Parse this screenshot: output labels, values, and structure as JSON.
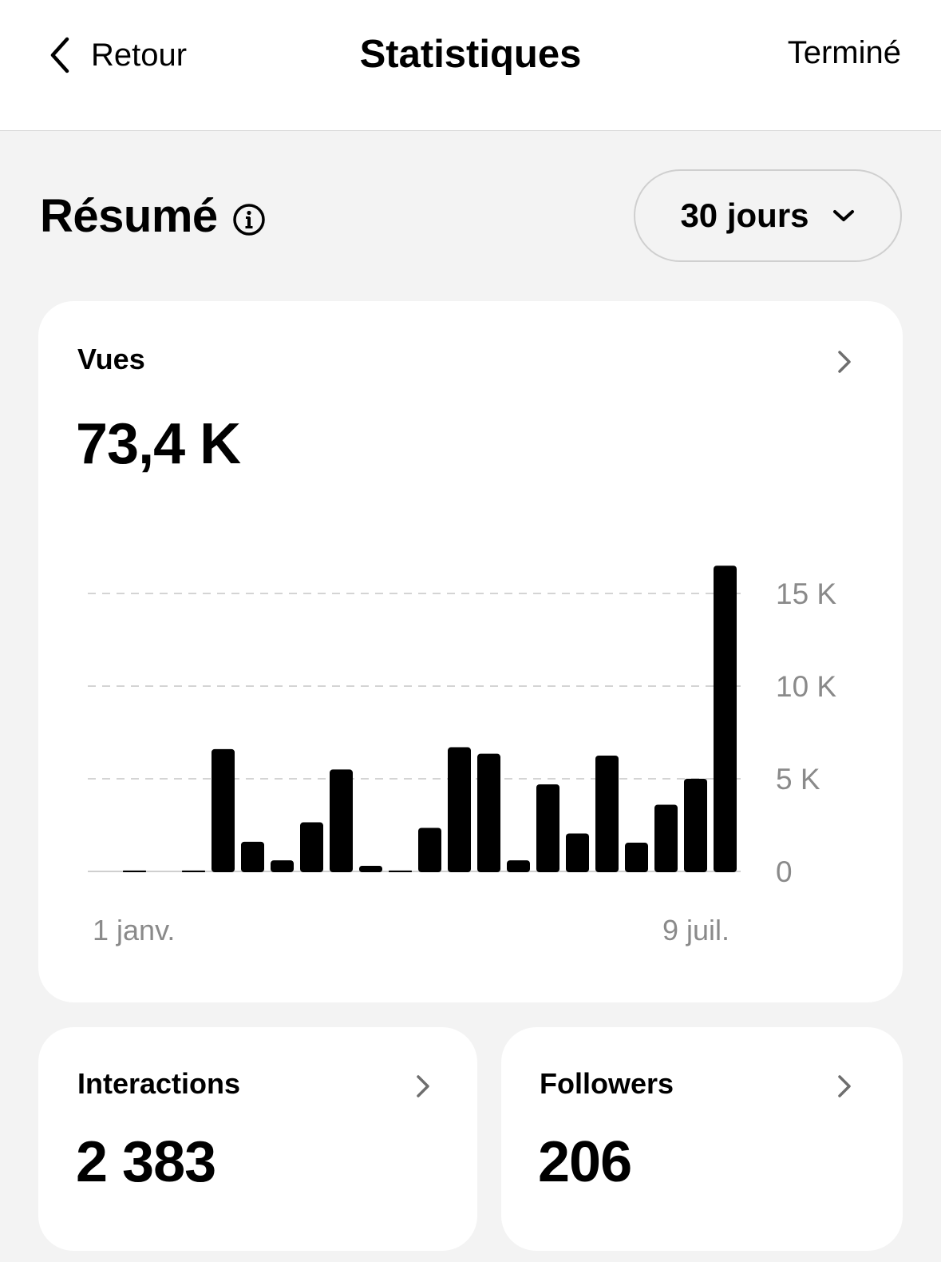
{
  "nav": {
    "back_label": "Retour",
    "title": "Statistiques",
    "done_label": "Terminé"
  },
  "summary": {
    "title": "Résumé",
    "period_label": "30 jours"
  },
  "views": {
    "label": "Vues",
    "value": "73,4 K"
  },
  "interactions": {
    "label": "Interactions",
    "value": "2 383"
  },
  "followers": {
    "label": "Followers",
    "value": "206"
  },
  "icons": {
    "back": "chevron-left-icon",
    "info": "info-icon",
    "dropdown": "chevron-down-icon",
    "more": "chevron-right-icon"
  },
  "colors": {
    "background": "#f3f3f3",
    "card": "#ffffff",
    "bar": "#000000",
    "muted": "#8a8a8a",
    "grid": "#d4d4d4"
  },
  "chart_data": {
    "type": "bar",
    "x_start_label": "1 janv.",
    "x_end_label": "9 juil.",
    "y_ticks": [
      {
        "value": 0,
        "label": "0"
      },
      {
        "value": 5000,
        "label": "5 K"
      },
      {
        "value": 10000,
        "label": "10 K"
      },
      {
        "value": 15000,
        "label": "15 K"
      }
    ],
    "ylim": [
      0,
      15000
    ],
    "grid": true,
    "values": [
      0,
      50,
      0,
      50,
      6600,
      1600,
      600,
      2650,
      5500,
      300,
      50,
      2350,
      6700,
      6350,
      600,
      4700,
      2050,
      6250,
      1550,
      3600,
      5000,
      16500
    ]
  }
}
